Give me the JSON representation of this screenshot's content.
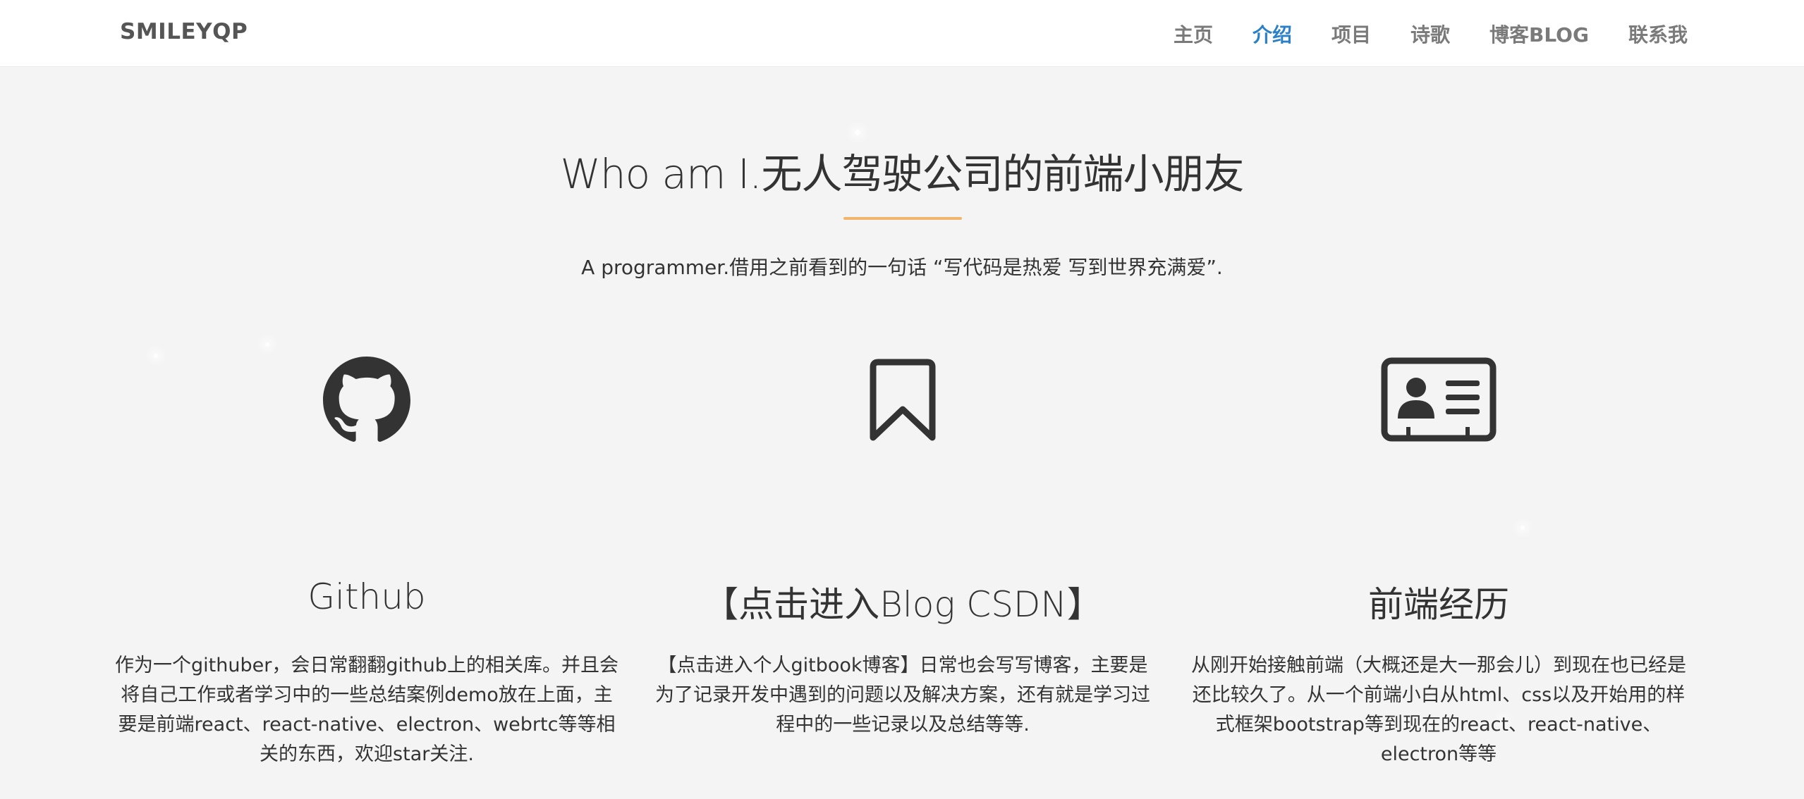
{
  "navbar": {
    "brand": "SMILEYQP",
    "items": [
      {
        "label": "主页",
        "active": false
      },
      {
        "label": "介绍",
        "active": true
      },
      {
        "label": "项目",
        "active": false
      },
      {
        "label": "诗歌",
        "active": false
      },
      {
        "label": "博客BLOG",
        "active": false
      },
      {
        "label": "联系我",
        "active": false
      }
    ]
  },
  "hero": {
    "title": "Who am I.无人驾驶公司的前端小朋友",
    "tagline": "A programmer.借用之前看到的一句话 “写代码是热爱 写到世界充满爱”."
  },
  "features": [
    {
      "icon": "github-icon",
      "title": "Github",
      "text": "作为一个githuber，会日常翻翻github上的相关库。并且会将自己工作或者学习中的一些总结案例demo放在上面，主要是前端react、react-native、electron、webrtc等等相关的东西，欢迎star关注."
    },
    {
      "icon": "bookmark-icon",
      "title": "【点击进入Blog CSDN】",
      "text": "【点击进入个人gitbook博客】日常也会写写博客，主要是为了记录开发中遇到的问题以及解决方案，还有就是学习过程中的一些记录以及总结等等."
    },
    {
      "icon": "id-card-icon",
      "title": "前端经历",
      "text": "从刚开始接触前端（大概还是大一那会儿）到现在也已经是还比较久了。从一个前端小白从html、css以及开始用的样式框架bootstrap等到现在的react、react-native、electron等等"
    }
  ],
  "colors": {
    "accent": "#2b80c8",
    "divider": "#f2b56e",
    "background": "#f4f4f4",
    "icon": "#333333"
  }
}
